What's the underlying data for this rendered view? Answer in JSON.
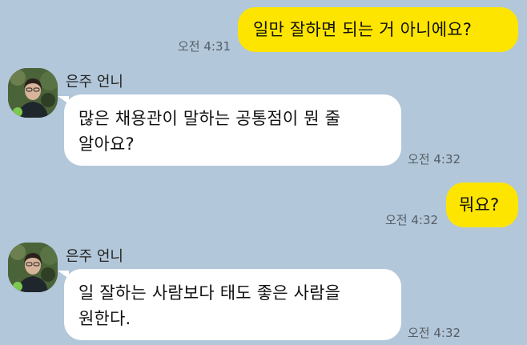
{
  "messages": [
    {
      "direction": "out",
      "text": "일만 잘하면 되는 거 아니에요?",
      "time": "오전 4:31"
    },
    {
      "direction": "in",
      "sender": "은주 언니",
      "lines": [
        "많은 채용관이 말하는 공통점이 뭔 줄",
        "알아요?"
      ],
      "time": "오전 4:32"
    },
    {
      "direction": "out",
      "text": "뭐요?",
      "time": "오전 4:32"
    },
    {
      "direction": "in",
      "sender": "은주 언니",
      "lines": [
        "일 잘하는 사람보다 태도 좋은 사람을",
        "원한다."
      ],
      "time": "오전 4:32"
    }
  ],
  "colors": {
    "background": "#b2c7d9",
    "outgoing_bubble": "#fee500",
    "incoming_bubble": "#ffffff"
  },
  "icons": {
    "avatar": "profile-photo"
  }
}
